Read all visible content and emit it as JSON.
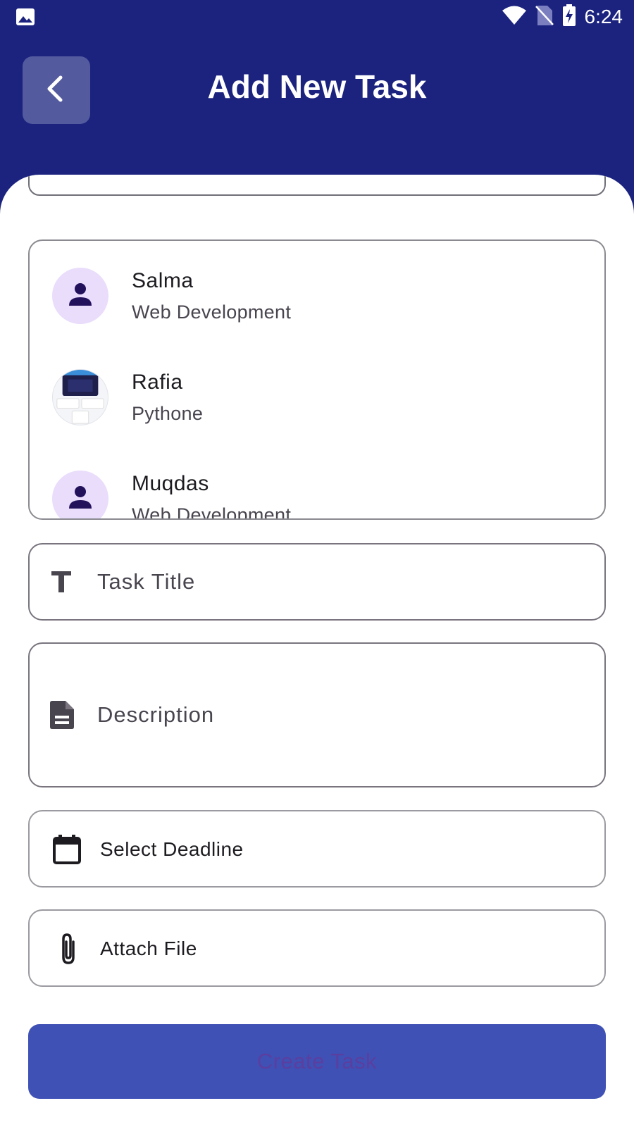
{
  "status_bar": {
    "time": "6:24"
  },
  "header": {
    "title": "Add New Task"
  },
  "users": [
    {
      "name": "Salma",
      "role": "Web Development",
      "avatar": "person-icon"
    },
    {
      "name": "Rafia",
      "role": "Pythone",
      "avatar": "photo"
    },
    {
      "name": "Muqdas",
      "role": "Web Development",
      "avatar": "person-icon"
    }
  ],
  "form": {
    "task_title_placeholder": "Task Title",
    "description_placeholder": "Description",
    "deadline_label": "Select Deadline",
    "attach_label": "Attach File",
    "create_label": "Create Task"
  },
  "colors": {
    "header_bg": "#1b237e",
    "button_bg": "#3f51b5",
    "avatar_bg": "#e9ddfb",
    "avatar_icon": "#24115c"
  }
}
